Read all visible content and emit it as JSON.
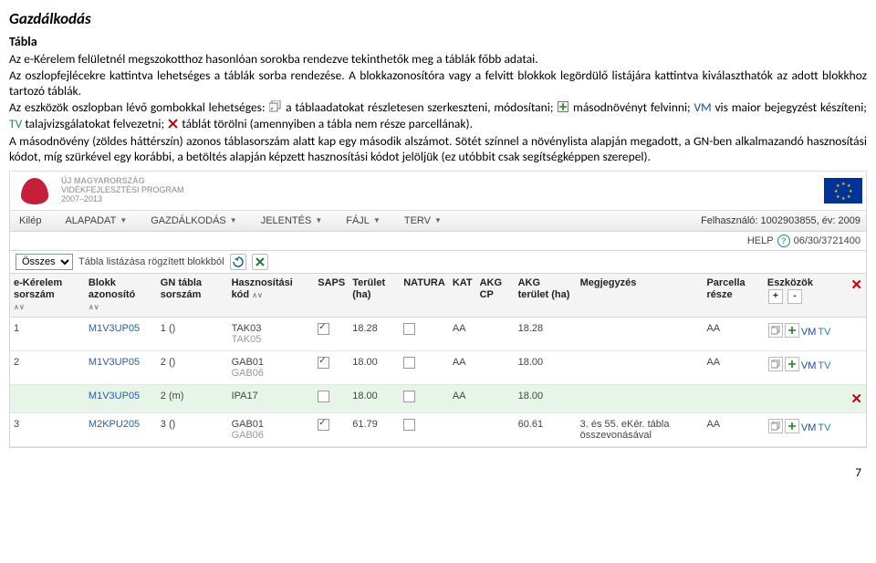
{
  "doc": {
    "heading": "Gazdálkodás",
    "subheading": "Tábla",
    "p1": "Az e-Kérelem felületnél megszokotthoz hasonlóan sorokba rendezve tekinthetők meg a táblák főbb adatai.",
    "p2": "Az oszlopfejlécekre kattintva lehetséges a táblák sorba rendezése. A blokkazonosítóra vagy a felvitt blokkok legördülő listájára kattintva kiválaszthatók az adott blokkhoz tartozó táblák.",
    "p3a": "Az eszközök oszlopban lévő gombokkal lehetséges:",
    "p3b": "a táblaadatokat részletesen szerkeszteni, módosítani;",
    "p3c": "másodnövényt felvinni;",
    "p3d_vm": "VM",
    "p3e": "vis maior bejegyzést készíteni;",
    "p3f_tv": "TV",
    "p3g": "talajvizsgálatokat felvezetni;",
    "p3h": "táblát törölni (amennyiben a tábla nem része parcellának).",
    "p4": "A másodnövény (zöldes háttérszín) azonos táblasorszám alatt kap egy második alszámot. Sötét színnel a növénylista alapján megadott, a GN-ben alkalmazandó hasznosítási kódot, míg szürkével egy korábbi, a betöltés alapján képzett hasznosítási kódot jelöljük (ez utóbbit csak segítségképpen szerepel)."
  },
  "banner": {
    "program1": "ÚJ MAGYARORSZÁG",
    "program2": "VIDÉKFEJLESZTÉSI PROGRAM",
    "years": "2007–2013"
  },
  "menu": {
    "exit": "Kilép",
    "items": [
      "ALAPADAT",
      "GAZDÁLKODÁS",
      "JELENTÉS",
      "FÁJL",
      "TERV"
    ],
    "user_label": "Felhasználó:",
    "user_val": "1002903855, év: 2009"
  },
  "help": {
    "label": "HELP",
    "code": "06/30/3721400"
  },
  "toolbar": {
    "filter": "Összes",
    "listlabel": "Tábla listázása rögzített blokkból"
  },
  "columns": {
    "c0": "e-Kérelem sorszám",
    "c1": "Blokk azonosító",
    "c2": "GN tábla sorszám",
    "c3": "Hasznosítási kód",
    "c4": "SAPS",
    "c5": "Terület (ha)",
    "c6": "NATURA",
    "c7": "KAT",
    "c8": "AKG CP",
    "c9": "AKG terület (ha)",
    "c10": "Megjegyzés",
    "c11": "Parcella része",
    "c12": "Eszközök",
    "plus": "+",
    "minus": "-"
  },
  "rows": [
    {
      "ek": "1",
      "bl": "M1V3UP05",
      "gn": "1 ()",
      "hk": "TAK03",
      "hk2": "TAK05",
      "saps": true,
      "ter": "18.28",
      "nat": false,
      "kat": "AA",
      "cp": "",
      "akgter": "18.28",
      "meg": "",
      "par": "AA",
      "tools": "full"
    },
    {
      "ek": "2",
      "bl": "M1V3UP05",
      "gn": "2 ()",
      "hk": "GAB01",
      "hk2": "GAB06",
      "saps": true,
      "ter": "18.00",
      "nat": false,
      "kat": "AA",
      "cp": "",
      "akgter": "18.00",
      "meg": "",
      "par": "AA",
      "tools": "full"
    },
    {
      "ek": "",
      "bl": "M1V3UP05",
      "gn": "2 (m)",
      "hk": "IPA17",
      "hk2": "",
      "saps": false,
      "ter": "18.00",
      "nat": false,
      "kat": "AA",
      "cp": "",
      "akgter": "18.00",
      "meg": "",
      "par": "",
      "tools": "xonly",
      "green": true
    },
    {
      "ek": "3",
      "bl": "M2KPU205",
      "gn": "3 ()",
      "hk": "GAB01",
      "hk2": "GAB06",
      "saps": true,
      "ter": "61.79",
      "nat": false,
      "kat": "",
      "cp": "",
      "akgter": "60.61",
      "meg": "3. és 55. eKér. tábla összevonásával",
      "par": "AA",
      "tools": "full"
    }
  ],
  "pageno": "7"
}
